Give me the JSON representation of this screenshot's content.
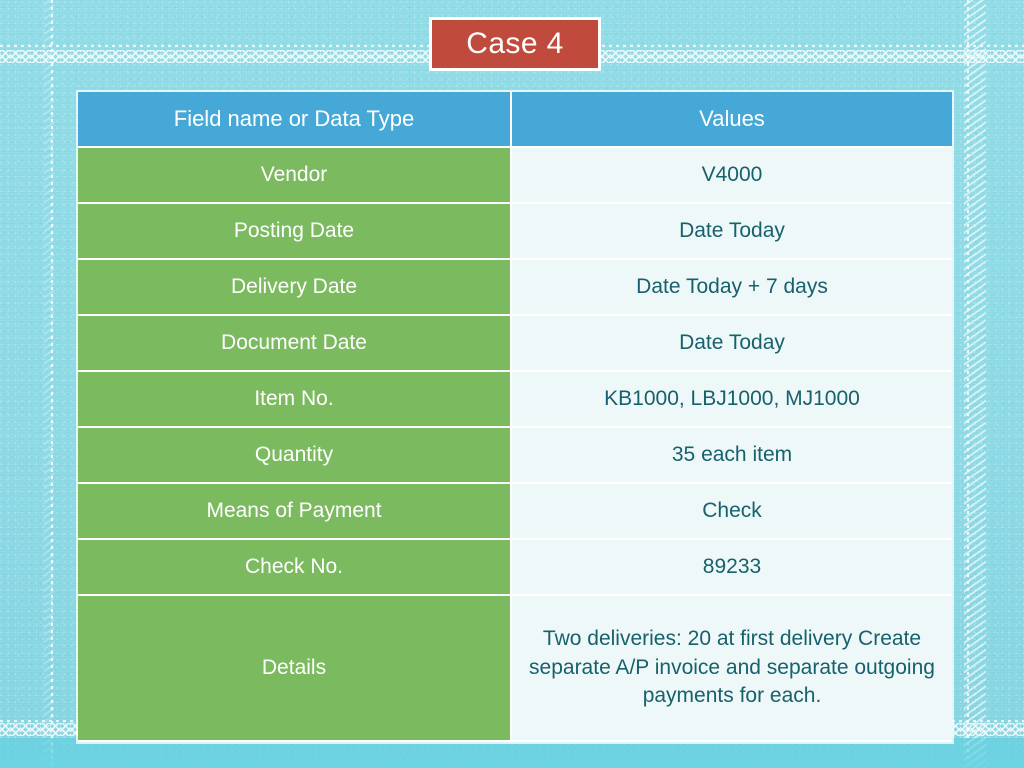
{
  "slide": {
    "title": "Case 4",
    "background_color": "#8cdae5",
    "title_box_color": "#c04a3c",
    "accent_header_color": "#46a8d6",
    "accent_field_color": "#7bba5e",
    "value_text_color": "#17616d"
  },
  "table": {
    "headers": {
      "field": "Field name or Data Type",
      "values": "Values"
    },
    "rows": [
      {
        "field": "Vendor",
        "value": "V4000"
      },
      {
        "field": "Posting Date",
        "value": "Date Today"
      },
      {
        "field": "Delivery Date",
        "value": "Date Today + 7 days"
      },
      {
        "field": "Document Date",
        "value": "Date Today"
      },
      {
        "field": "Item No.",
        "value": "KB1000, LBJ1000, MJ1000"
      },
      {
        "field": "Quantity",
        "value": "35 each item"
      },
      {
        "field": "Means of Payment",
        "value": "Check"
      },
      {
        "field": "Check No.",
        "value": "89233"
      },
      {
        "field": "Details",
        "value": "Two deliveries: 20 at first delivery Create separate A/P invoice and separate outgoing payments for each."
      }
    ]
  }
}
